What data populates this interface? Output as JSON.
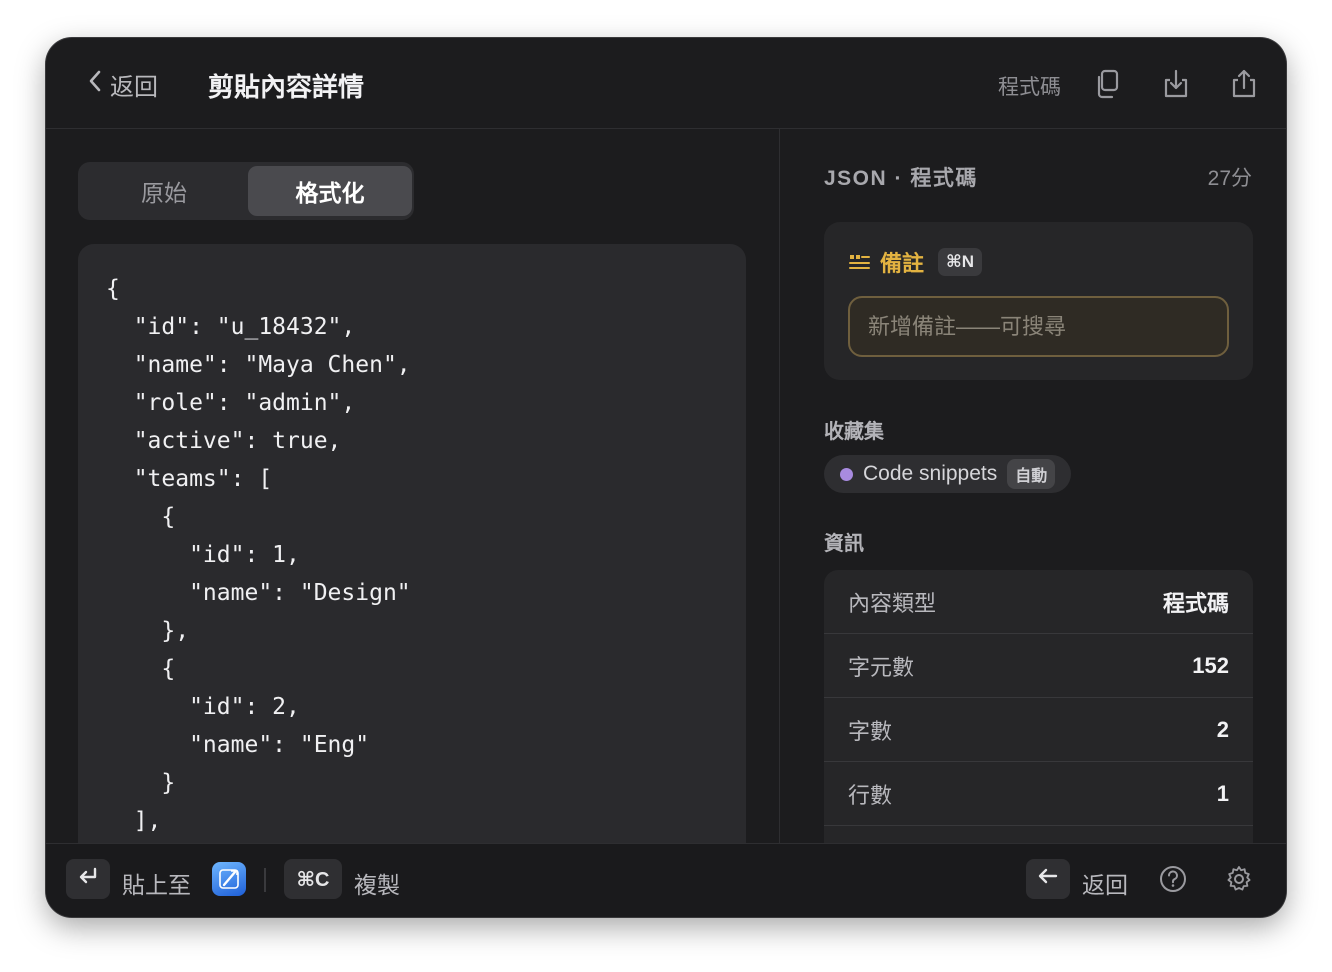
{
  "header": {
    "back_label": "返回",
    "title": "剪貼內容詳情",
    "type_label": "程式碼"
  },
  "segmented": {
    "raw": "原始",
    "formatted": "格式化",
    "selected": "格式化"
  },
  "code": {
    "lines": [
      "{",
      "  \"id\": \"u_18432\",",
      "  \"name\": \"Maya Chen\",",
      "  \"role\": \"admin\",",
      "  \"active\": true,",
      "  \"teams\": [",
      "    {",
      "      \"id\": 1,",
      "      \"name\": \"Design\"",
      "    },",
      "    {",
      "      \"id\": 2,",
      "      \"name\": \"Eng\"",
      "    }",
      "  ],"
    ]
  },
  "meta": {
    "type": "JSON · 程式碼",
    "time": "27分"
  },
  "note": {
    "label": "備註",
    "shortcut": "⌘N",
    "placeholder": "新增備註——可搜尋"
  },
  "collection": {
    "heading": "收藏集",
    "name": "Code snippets",
    "badge": "自動",
    "dot_color": "#a88be0"
  },
  "info": {
    "heading": "資訊",
    "rows": [
      {
        "key": "內容類型",
        "value": "程式碼"
      },
      {
        "key": "字元數",
        "value": "152"
      },
      {
        "key": "字數",
        "value": "2"
      },
      {
        "key": "行數",
        "value": "1"
      }
    ]
  },
  "footer": {
    "paste_label": "貼上至",
    "copy_key": "⌘C",
    "copy_label": "複製",
    "back_label": "返回"
  },
  "colors": {
    "accent_note": "#e3b341",
    "background": "#1c1c1e"
  }
}
